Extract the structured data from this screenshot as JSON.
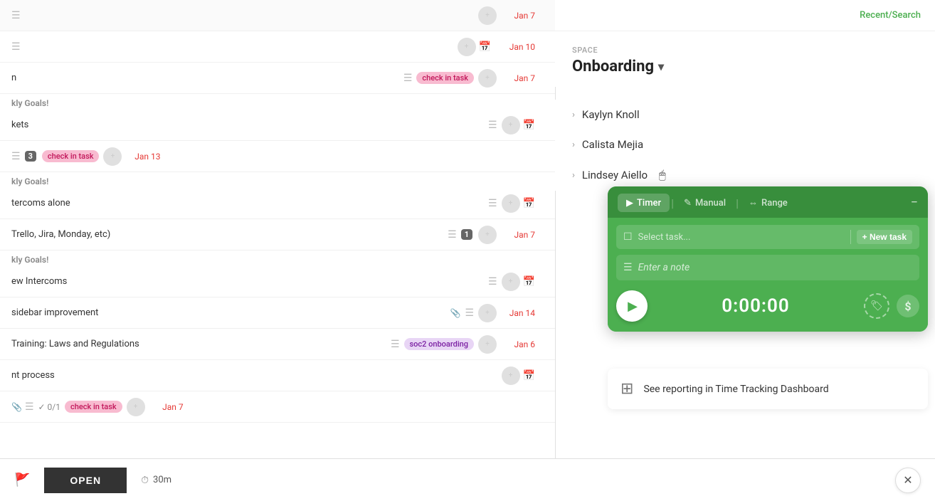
{
  "header": {
    "recent_search_label": "Recent/Search"
  },
  "space": {
    "label": "SPACE",
    "name": "Onboarding"
  },
  "people": [
    {
      "name": "Kaylyn Knoll"
    },
    {
      "name": "Calista Mejia"
    },
    {
      "name": "Lindsey Aiello"
    }
  ],
  "timer_widget": {
    "minimize_symbol": "−",
    "tabs": [
      {
        "label": "Timer",
        "icon": "▶",
        "active": true
      },
      {
        "label": "Manual",
        "icon": "✎",
        "active": false
      },
      {
        "label": "Range",
        "icon": "⟺",
        "active": false
      }
    ],
    "task_select_placeholder": "Select task...",
    "new_task_label": "+ New task",
    "note_placeholder": "Enter a note",
    "timer_display": "0:00:00",
    "play_icon": "▶",
    "tag_icon": "🏷",
    "dollar_icon": "$"
  },
  "reporting": {
    "text": "See reporting in Time Tracking Dashboard",
    "icon": "⊞"
  },
  "tasks": [
    {
      "name": "",
      "date": "Jan 7",
      "has_avatar": true
    },
    {
      "name": "",
      "date": "Jan 10",
      "has_avatar": true,
      "has_calendar": true
    },
    {
      "name": "n",
      "tag": "check in task",
      "tag_type": "pink",
      "date": "Jan 7",
      "has_avatar": true
    },
    {
      "name": "",
      "section": "kly Goals!",
      "subname": "kets",
      "has_avatar": true,
      "has_calendar": true
    },
    {
      "name": "3",
      "tag": "check in task",
      "tag_type": "pink",
      "date": "Jan 13",
      "has_avatar": true
    },
    {
      "name": "",
      "section": "kly Goals!",
      "subname": "tercoms alone",
      "has_avatar": true,
      "has_calendar": true
    },
    {
      "name": "Trello, Jira, Monday, etc)",
      "badge": "1",
      "date": "Jan 7",
      "has_avatar": true
    },
    {
      "name": "",
      "section": "kly Goals!",
      "subname": "ew Intercoms",
      "has_avatar": true,
      "has_calendar": true
    },
    {
      "name": "sidebar improvement",
      "date": "Jan 14",
      "has_avatar": true,
      "has_clip": true
    },
    {
      "name": "Training: Laws and Regulations",
      "tag": "soc2 onboarding",
      "tag_type": "purple",
      "date": "Jan 6",
      "has_avatar": true
    },
    {
      "name": "",
      "subname": "nt process",
      "has_avatar": true,
      "has_calendar": true
    },
    {
      "name": "",
      "checkmark": "0/1",
      "tag": "check in task",
      "tag_type": "pink",
      "date": "Jan 7",
      "has_clip": true
    }
  ],
  "bottom_bar": {
    "open_label": "OPEN",
    "time_label": "30m",
    "time_icon": "⏱"
  }
}
